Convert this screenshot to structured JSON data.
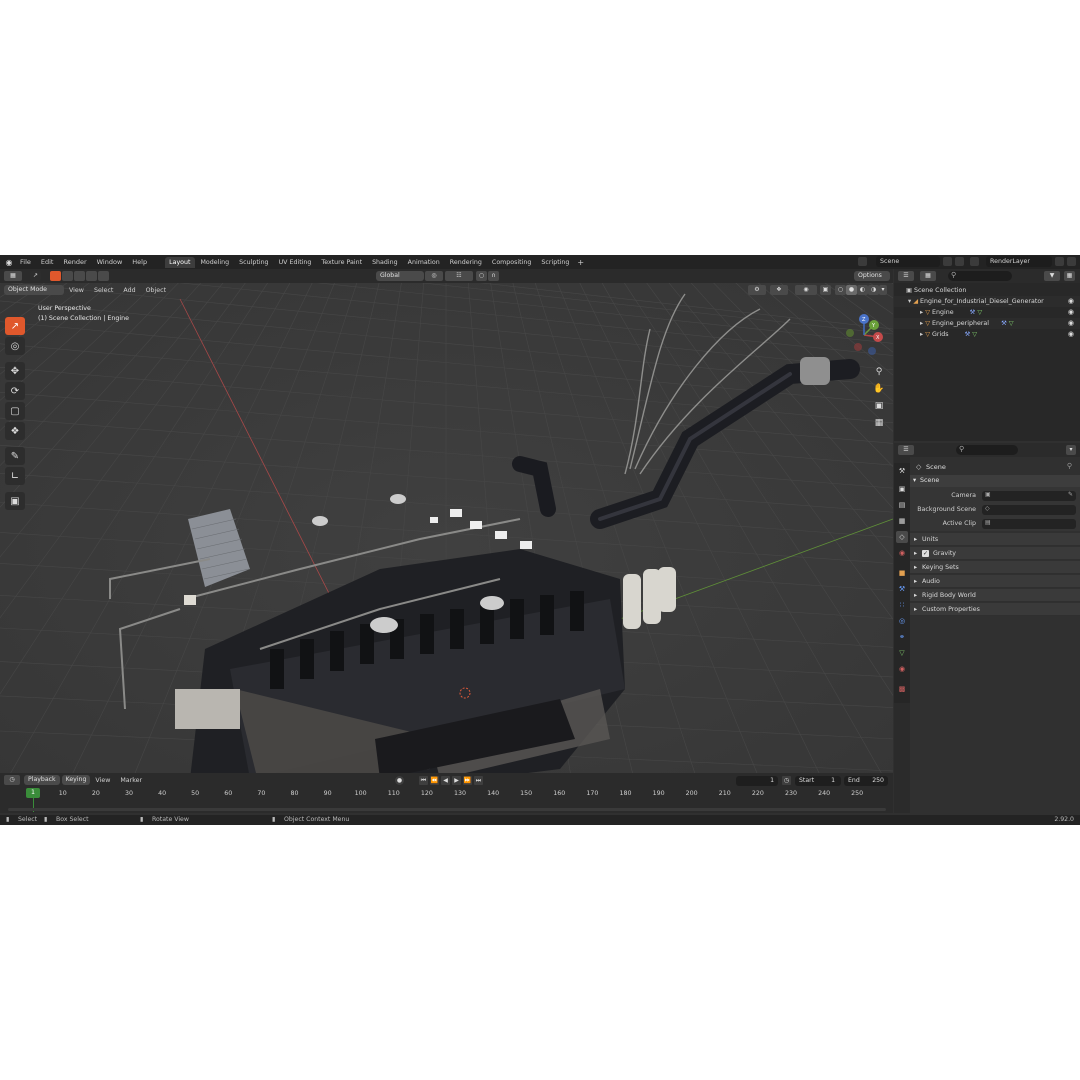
{
  "topbar": {
    "menus": [
      "File",
      "Edit",
      "Render",
      "Window",
      "Help"
    ],
    "workspaces": [
      "Layout",
      "Modeling",
      "Sculpting",
      "UV Editing",
      "Texture Paint",
      "Shading",
      "Animation",
      "Rendering",
      "Compositing",
      "Scripting"
    ],
    "active_workspace": "Layout",
    "add_workspace": "+",
    "scene": "Scene",
    "view_layer": "RenderLayer"
  },
  "viewport": {
    "mode": "Object Mode",
    "menus": [
      "View",
      "Select",
      "Add",
      "Object"
    ],
    "transform_orientation": "Global",
    "options_label": "Options",
    "perspective_label": "User Perspective",
    "collection_label": "(1) Scene Collection | Engine",
    "gizmo": {
      "x": "X",
      "y": "Y",
      "z": "Z"
    }
  },
  "toolbar": {
    "tools": [
      "select-box",
      "cursor",
      "move",
      "rotate",
      "scale",
      "transform",
      "annotate",
      "measure",
      "add-cube"
    ],
    "active_tool": "select-box"
  },
  "timeline": {
    "menus": [
      "Playback",
      "Keying",
      "View",
      "Marker"
    ],
    "current_frame": "1",
    "start_label": "Start",
    "start": "1",
    "end_label": "End",
    "end": "250",
    "ticks": [
      "10",
      "20",
      "30",
      "40",
      "50",
      "60",
      "70",
      "80",
      "90",
      "100",
      "110",
      "120",
      "130",
      "140",
      "150",
      "160",
      "170",
      "180",
      "190",
      "200",
      "210",
      "220",
      "230",
      "240",
      "250"
    ]
  },
  "statusbar": {
    "select": "Select",
    "box_select": "Box Select",
    "rotate_view": "Rotate View",
    "context_menu": "Object Context Menu",
    "version": "2.92.0"
  },
  "outliner": {
    "root": "Scene Collection",
    "collection": "Engine_for_Industrial_Diesel_Generator",
    "objects": [
      "Engine",
      "Engine_peripheral",
      "Grids"
    ]
  },
  "properties": {
    "title": "Scene",
    "panel": "Scene",
    "camera_label": "Camera",
    "background_scene_label": "Background Scene",
    "active_clip_label": "Active Clip",
    "subpanels": [
      "Units",
      "Gravity",
      "Keying Sets",
      "Audio",
      "Rigid Body World",
      "Custom Properties"
    ]
  },
  "colors": {
    "accent_orange": "#e0582c",
    "frame_green": "#3a8d3a",
    "axis_red": "#b84444",
    "axis_green": "#6a9a3a"
  }
}
